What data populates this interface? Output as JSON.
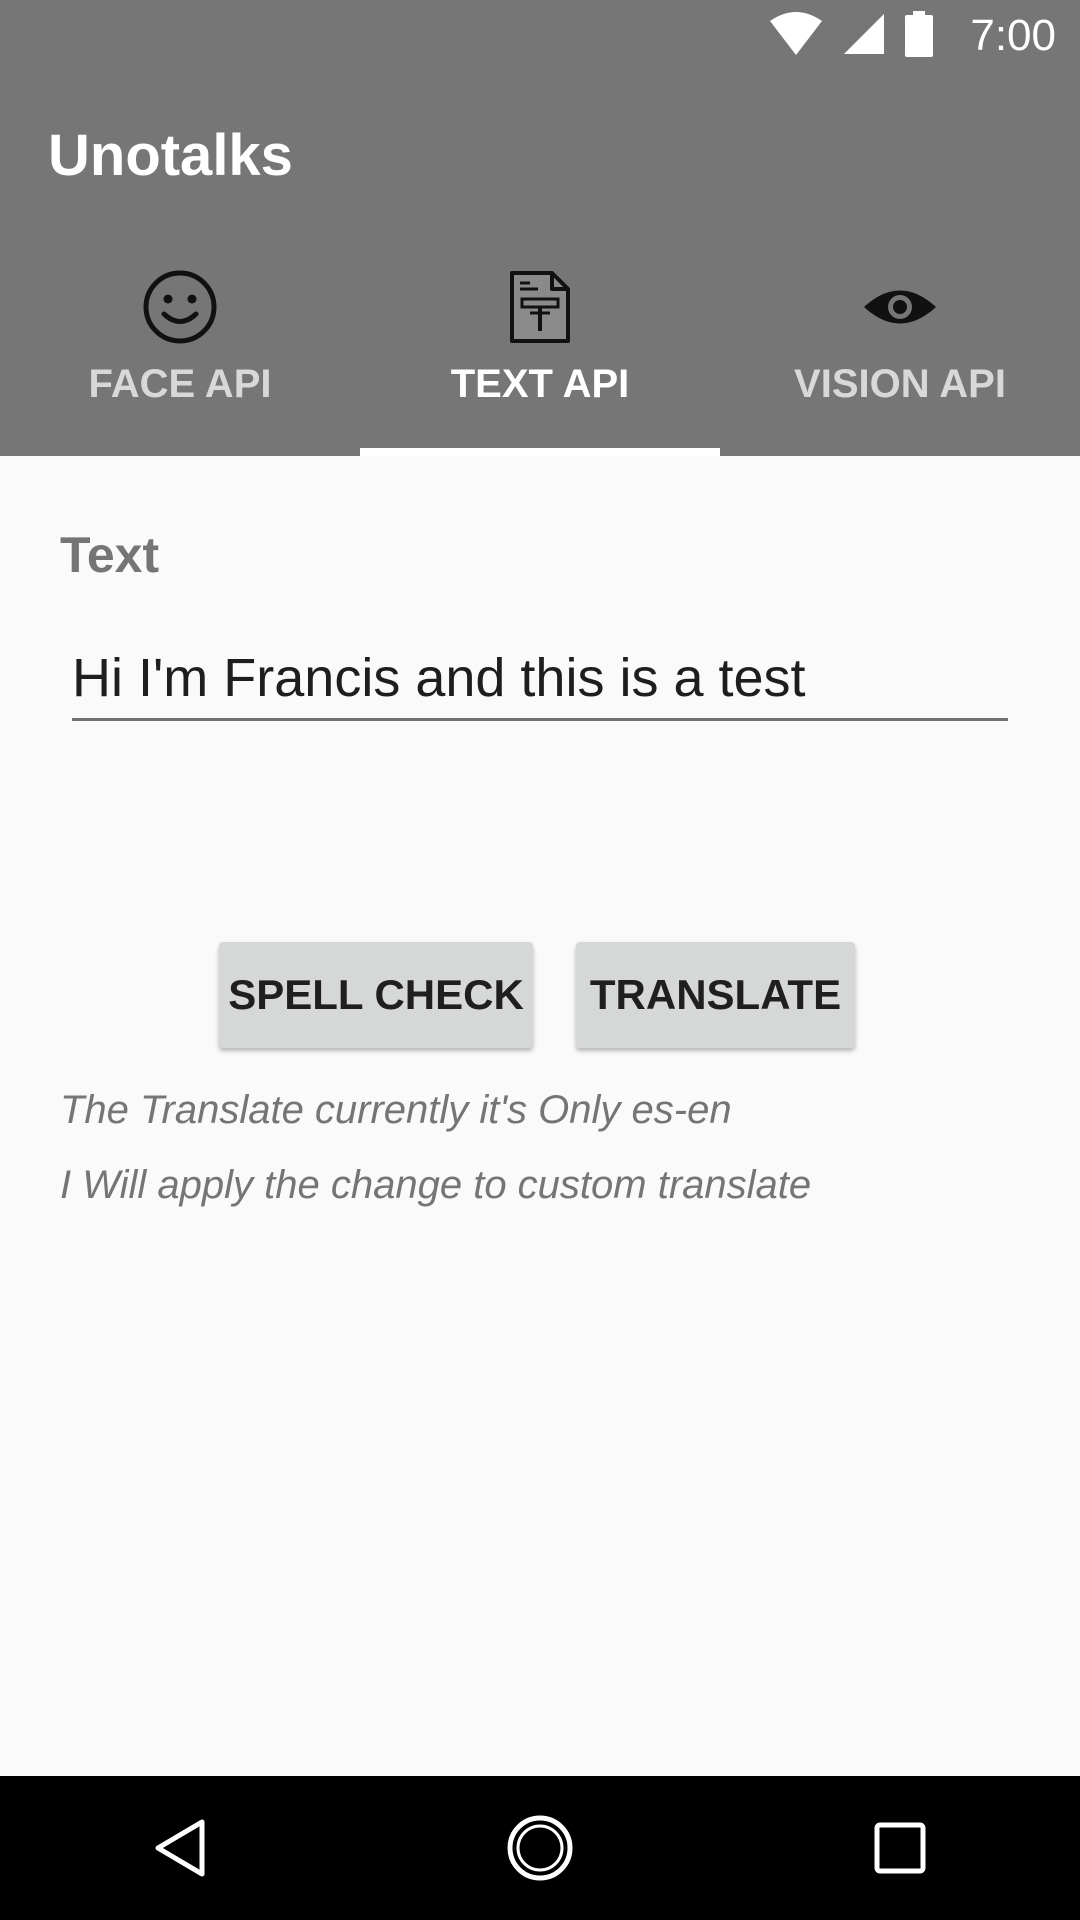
{
  "status_bar": {
    "time": "7:00",
    "icons": [
      "wifi-icon",
      "cell-signal-icon",
      "battery-icon"
    ]
  },
  "app": {
    "title": "Unotalks"
  },
  "tabs": [
    {
      "label": "FACE API",
      "icon": "smiley-face-icon",
      "active": false
    },
    {
      "label": "TEXT API",
      "icon": "text-document-icon",
      "active": true
    },
    {
      "label": "VISION API",
      "icon": "eye-icon",
      "active": false
    }
  ],
  "form": {
    "field_label": "Text",
    "input_value": "Hi I'm Francis and this is a test"
  },
  "buttons": {
    "spell_check": "SPELL CHECK",
    "translate": "TRANSLATE"
  },
  "notes": [
    "The Translate currently it's Only es-en",
    "I Will apply the change to custom translate"
  ],
  "navigation": {
    "icons": [
      "back-icon",
      "home-icon",
      "recents-icon"
    ]
  },
  "colors": {
    "appbar": "#767676",
    "background": "#fafafa",
    "button": "#d6d7d7",
    "tab_active": "#ffffff",
    "tab_inactive": "#d8d8d8"
  }
}
